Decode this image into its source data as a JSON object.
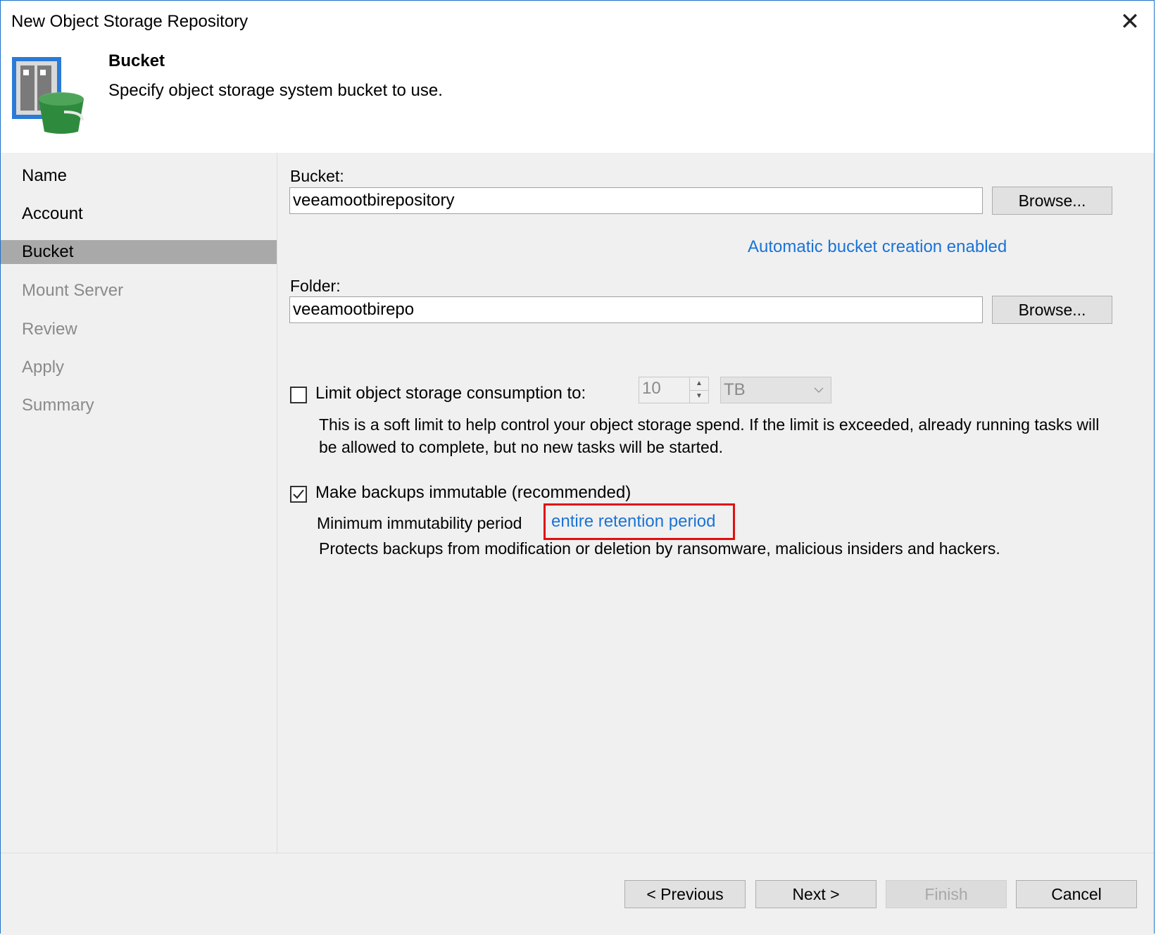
{
  "window": {
    "title": "New Object Storage Repository",
    "close_glyph": "✕"
  },
  "header": {
    "step_title": "Bucket",
    "step_description": "Specify object storage system bucket to use."
  },
  "nav": {
    "items": [
      {
        "label": "Name",
        "state": "done"
      },
      {
        "label": "Account",
        "state": "done"
      },
      {
        "label": "Bucket",
        "state": "active"
      },
      {
        "label": "Mount Server",
        "state": "pending"
      },
      {
        "label": "Review",
        "state": "pending"
      },
      {
        "label": "Apply",
        "state": "pending"
      },
      {
        "label": "Summary",
        "state": "pending"
      }
    ]
  },
  "bucket": {
    "label": "Bucket:",
    "value": "veeamootbirepository",
    "browse_label": "Browse...",
    "auto_creation_link": "Automatic bucket creation enabled"
  },
  "folder": {
    "label": "Folder:",
    "value": "veeamootbirepo",
    "browse_label": "Browse..."
  },
  "limit": {
    "checked": false,
    "label": "Limit object storage consumption to:",
    "value": "10",
    "unit": "TB",
    "description_line1": "This is a soft limit to help control your object storage spend. If the limit is exceeded, already running tasks will",
    "description_line2": "be allowed to complete, but no new tasks will be started."
  },
  "immutable": {
    "checked": true,
    "label": "Make backups immutable (recommended)",
    "period_label": "Minimum immutability period",
    "period_link": "entire retention period",
    "description": "Protects backups from modification or deletion by ransomware, malicious insiders and hackers."
  },
  "footer": {
    "previous_label": "< Previous",
    "next_label": "Next >",
    "finish_label": "Finish",
    "cancel_label": "Cancel"
  },
  "colors": {
    "accent": "#1a73d6",
    "highlight": "#e01010",
    "active_nav": "#a9a9a9"
  }
}
